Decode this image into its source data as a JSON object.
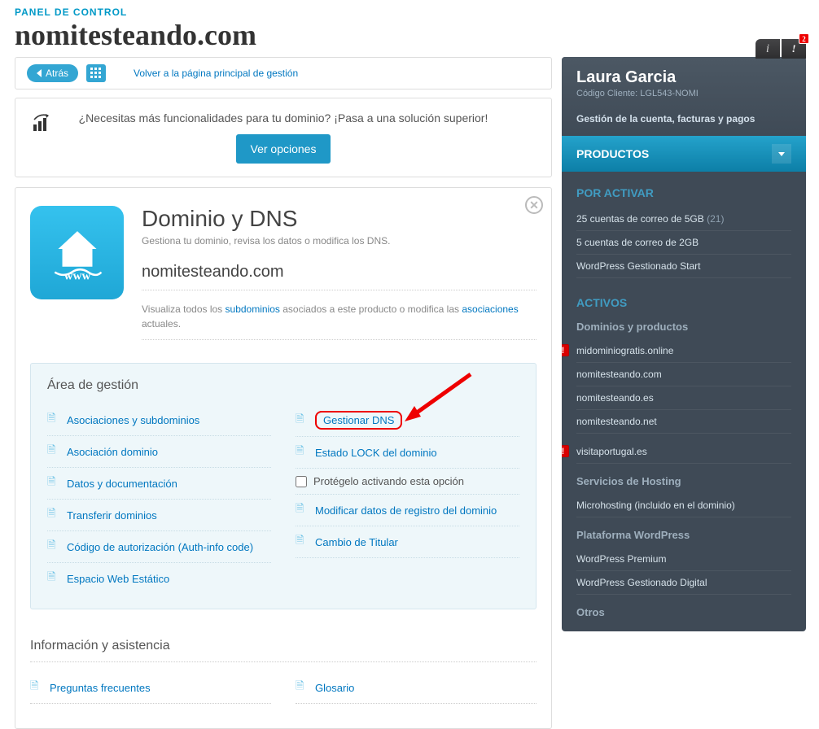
{
  "breadcrumb": "PANEL DE CONTROL",
  "page_title": "nomitesteando.com",
  "header_bar": {
    "back_label": "Atrás",
    "back_link": "Volver a la página principal de gestión"
  },
  "upsell": {
    "text": "¿Necesitas más funcionalidades para tu dominio? ¡Pasa a una solución superior!",
    "button": "Ver opciones"
  },
  "domain_panel": {
    "title": "Dominio y DNS",
    "subtitle": "Gestiona tu dominio, revisa los datos o modifica los DNS.",
    "domain_name": "nomitesteando.com",
    "desc_start": "Visualiza todos los ",
    "desc_link1": "subdominios",
    "desc_mid": " asociados a este producto o modifica las ",
    "desc_link2": "asociaciones",
    "desc_end": " actuales.",
    "mgmt_title": "Área de gestión",
    "left_links": [
      "Asociaciones y subdominios",
      "Asociación dominio",
      "Datos y documentación",
      "Transferir dominios",
      "Código de autorización (Auth-info code)",
      "Espacio Web Estático"
    ],
    "right_links": {
      "gestionar_dns": "Gestionar DNS",
      "estado_lock": "Estado LOCK del dominio",
      "protect_label": "Protégelo activando esta opción",
      "modificar_datos": "Modificar datos de registro del dominio",
      "cambio_titular": "Cambio de Titular"
    },
    "info_title": "Información y asistencia",
    "info_links": {
      "faq": "Preguntas frecuentes",
      "glosario": "Glosario"
    }
  },
  "sidebar": {
    "badge_count": "2",
    "user_name": "Laura Garcia",
    "client_code_label": "Código Cliente: ",
    "client_code": "LGL543-NOMI",
    "account_link": "Gestión de la cuenta, facturas y pagos",
    "products_label": "PRODUCTOS",
    "por_activar": {
      "title": "POR ACTIVAR",
      "items": [
        {
          "label": "25 cuentas de correo de 5GB",
          "count": "(21)"
        },
        {
          "label": "5 cuentas de correo de 2GB",
          "count": ""
        },
        {
          "label": "WordPress Gestionado Start",
          "count": ""
        }
      ]
    },
    "activos": {
      "title": "ACTIVOS",
      "domains_title": "Dominios y productos",
      "domains": [
        {
          "label": "midominiogratis.online",
          "alert": true
        },
        {
          "label": "nomitesteando.com",
          "alert": false
        },
        {
          "label": "nomitesteando.es",
          "alert": false
        },
        {
          "label": "nomitesteando.net",
          "alert": false
        },
        {
          "label": "visitaportugal.es",
          "alert": true
        }
      ],
      "hosting_title": "Servicios de Hosting",
      "hosting": [
        {
          "label": "Microhosting (incluido en el dominio)"
        }
      ],
      "wp_title": "Plataforma WordPress",
      "wp": [
        {
          "label": "WordPress Premium"
        },
        {
          "label": "WordPress Gestionado Digital"
        }
      ],
      "otros_title": "Otros"
    }
  }
}
